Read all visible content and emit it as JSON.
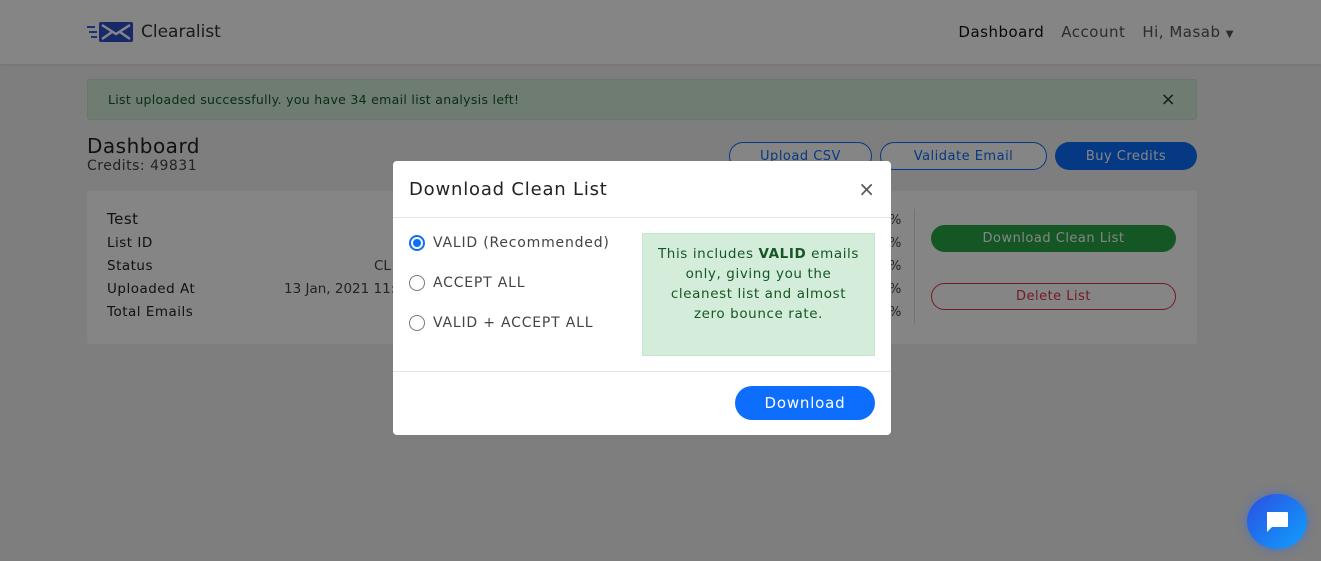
{
  "nav": {
    "brand": "Clearalist",
    "links": [
      "Dashboard",
      "Account"
    ],
    "user": "Hi, Masab"
  },
  "alert": {
    "message": "List uploaded successfully. you have 34 email list analysis left!",
    "close": "×"
  },
  "page": {
    "title": "Dashboard",
    "credits": "Credits: 49831"
  },
  "toolbar": {
    "upload": "Upload CSV",
    "validate": "Validate Email",
    "buy": "Buy Credits"
  },
  "card": {
    "name": "Test",
    "labels": [
      "List ID",
      "Status",
      "Uploaded At",
      "Total Emails"
    ],
    "status_partial": "CL",
    "uploaded_partial": "13 Jan, 2021 11:",
    "pct": "%",
    "download": "Download Clean List",
    "delete": "Delete List"
  },
  "modal": {
    "title": "Download Clean List",
    "close": "×",
    "options": [
      {
        "label": "VALID (Recommended)",
        "selected": true
      },
      {
        "label": "ACCEPT ALL",
        "selected": false
      },
      {
        "label": "VALID + ACCEPT ALL",
        "selected": false
      }
    ],
    "info_pre": "This includes ",
    "info_bold": "VALID",
    "info_post": " emails only, giving you the cleanest list and almost zero bounce rate.",
    "download": "Download"
  },
  "colors": {
    "primary": "#0d6efd",
    "success": "#28a745",
    "danger": "#dc3545",
    "alert_bg": "#d4edda"
  }
}
